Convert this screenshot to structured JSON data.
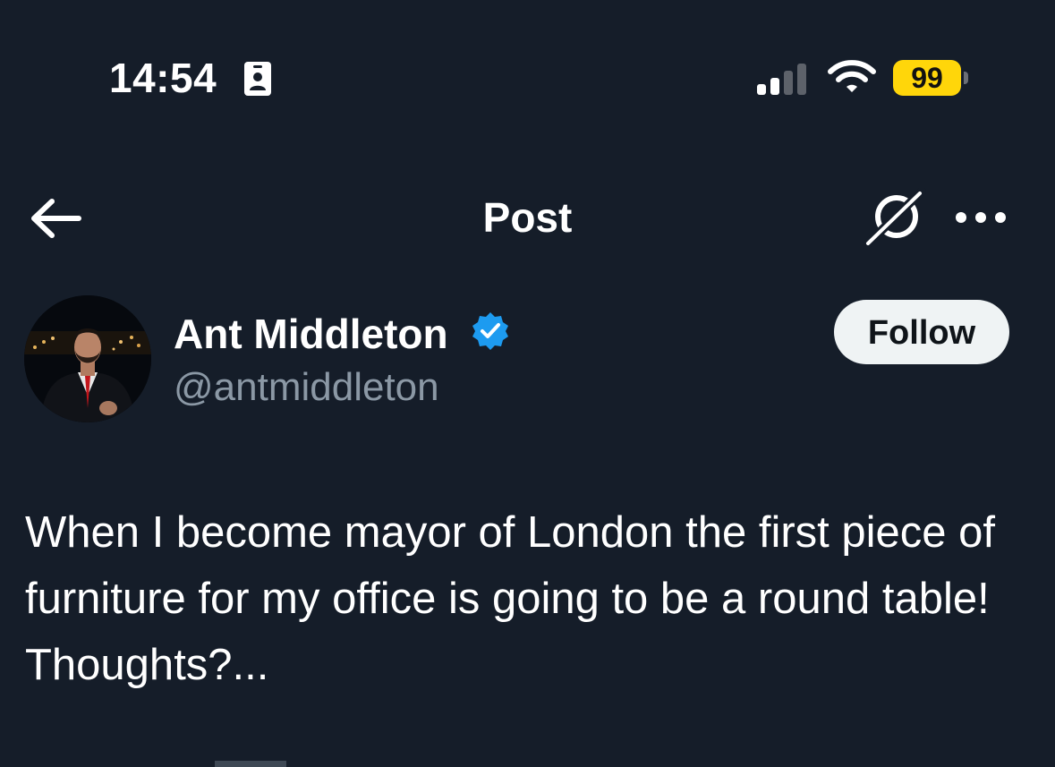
{
  "status_bar": {
    "time": "14:54",
    "battery_level": "99",
    "battery_color": "#ffd60a",
    "icons": [
      "id-card-icon",
      "cellular-signal-icon",
      "wifi-icon",
      "battery-icon"
    ]
  },
  "header": {
    "title": "Post",
    "icons": [
      "back-arrow-icon",
      "grok-icon",
      "more-options-icon"
    ]
  },
  "author": {
    "name": "Ant Middleton",
    "handle": "@antmiddleton",
    "verified": true,
    "verified_color": "#1d9bf0",
    "follow_label": "Follow"
  },
  "post": {
    "text": "When I become mayor of London the first piece of furniture for my office is going to be a round table! Thoughts?..."
  },
  "theme": {
    "background": "#151d29",
    "secondary_text": "#8b98a5"
  }
}
